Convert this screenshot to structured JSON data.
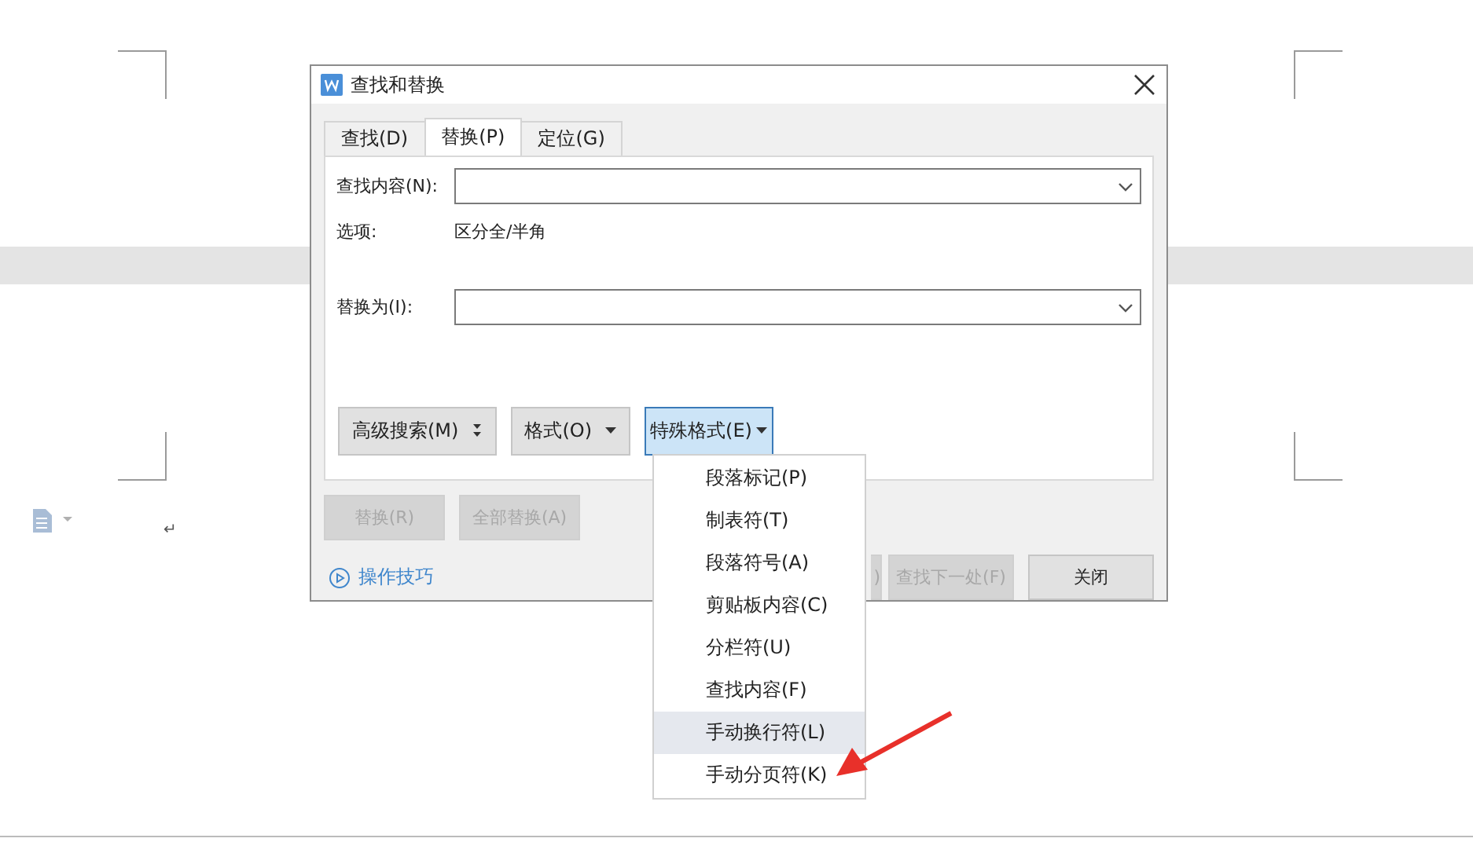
{
  "document": {
    "paragraph_mark": "↵"
  },
  "dialog": {
    "title": "查找和替换",
    "tabs": [
      {
        "label": "查找(D)",
        "selected": false
      },
      {
        "label": "替换(P)",
        "selected": true
      },
      {
        "label": "定位(G)",
        "selected": false
      }
    ],
    "find_field": {
      "label": "查找内容(N):"
    },
    "options": {
      "label": "选项:",
      "value": "区分全/半角"
    },
    "replace_field": {
      "label": "替换为(I):"
    },
    "format_buttons": [
      {
        "label": "高级搜索(M)",
        "kind": "expand",
        "selected": false
      },
      {
        "label": "格式(O)",
        "kind": "dropdown",
        "selected": false
      },
      {
        "label": "特殊格式(E)",
        "kind": "dropdown",
        "selected": true
      }
    ],
    "replace_buttons": [
      {
        "label": "替换(R)",
        "disabled": true
      },
      {
        "label": "全部替换(A)",
        "disabled": true
      }
    ],
    "tips_link": "操作技巧",
    "bottom_buttons": [
      {
        "label": ")",
        "disabled": true
      },
      {
        "label": "查找下一处(F)",
        "disabled": true
      },
      {
        "label": "关闭",
        "disabled": false
      }
    ]
  },
  "special_menu": {
    "items": [
      {
        "label": "段落标记(P)",
        "selected": false
      },
      {
        "label": "制表符(T)",
        "selected": false
      },
      {
        "label": "段落符号(A)",
        "selected": false
      },
      {
        "label": "剪贴板内容(C)",
        "selected": false
      },
      {
        "label": "分栏符(U)",
        "selected": false
      },
      {
        "label": "查找内容(F)",
        "selected": false
      },
      {
        "label": "手动换行符(L)",
        "selected": true
      },
      {
        "label": "手动分页符(K)",
        "selected": false
      }
    ]
  }
}
